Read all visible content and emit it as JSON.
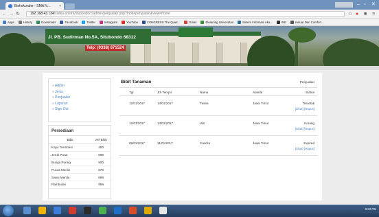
{
  "browser": {
    "tab_title": "Bishokuruler - SMA N...",
    "tab_close": "×",
    "user_chip": "",
    "url_host": "192.168.43.134",
    "url_path": "/sistka-smant/stubondo/c/admin/penjualan.php?mod=penjualan&view=home",
    "bookmarks": [
      {
        "label": "Apps",
        "color": "#4a7cc9"
      },
      {
        "label": "History",
        "color": "#777777"
      },
      {
        "label": "Downloads",
        "color": "#2e8b57"
      },
      {
        "label": "Facebook",
        "color": "#3b5998"
      },
      {
        "label": "Twitter",
        "color": "#1da1f2"
      },
      {
        "label": "Instagram",
        "color": "#c13584"
      },
      {
        "label": "YouTube",
        "color": "#e52d27"
      },
      {
        "label": "CONGRESS The Quiet...",
        "color": "#2a4d8f"
      },
      {
        "label": "Gmail",
        "color": "#d44638"
      },
      {
        "label": "Elearning Universitas",
        "color": "#3a8f3a"
      },
      {
        "label": "Sistem Informasi Aka...",
        "color": "#2a6f97"
      },
      {
        "label": "INE",
        "color": "#333333"
      },
      {
        "label": "Keluar Dari Comfort...",
        "color": "#555555"
      }
    ]
  },
  "banner": {
    "address_line": "Jl. PB. Sudirman No.5A, Situbondo 68312",
    "phone_line": "Telp: (0338) 671524"
  },
  "menu": {
    "items": [
      "Admin",
      "Jenis",
      "Penjualan",
      "Laporan",
      "Sign Out"
    ]
  },
  "stock": {
    "title": "Persediaan",
    "headers": [
      "Bibit",
      "Jml Bibit"
    ],
    "rows": [
      {
        "name": "Kayu Trembesi",
        "qty": "400"
      },
      {
        "name": "Jeruk Purut",
        "qty": "899"
      },
      {
        "name": "Bunga Puring",
        "qty": "900"
      },
      {
        "name": "Pucuk Merah",
        "qty": "878"
      },
      {
        "name": "Sawo Manila",
        "qty": "899"
      },
      {
        "name": "Rambutan",
        "qty": "999"
      }
    ]
  },
  "main": {
    "title": "Bibit Tanaman",
    "right_label": "Penjualan",
    "columns": [
      "Tgl",
      "Jth Tempo",
      "Nama",
      "Alamat",
      "Status"
    ],
    "rows": [
      {
        "tgl": "12/01/2017",
        "tempo": "14/01/2017",
        "nama": "Fatwa",
        "alamat": "Jawa Timur",
        "status": "Tercetak",
        "actions": "[Lihat] [Hapus]"
      },
      {
        "tgl": "12/01/2017",
        "tempo": "14/01/2017",
        "nama": "Visi",
        "alamat": "Jawa Timur",
        "status": "Kurang",
        "actions": "[Lihat] [Hapus]"
      },
      {
        "tgl": "09/01/2017",
        "tempo": "11/01/2017",
        "nama": "Candra",
        "alamat": "Jawa Timur",
        "status": "Expired",
        "actions": "[Lihat] [Hapus]"
      }
    ]
  },
  "taskbar": {
    "time": "9:22 PM",
    "apps": [
      {
        "color": "#5b8fd0"
      },
      {
        "color": "#f0b400"
      },
      {
        "color": "#3b7dd8"
      },
      {
        "color": "#cf3b2f"
      },
      {
        "color": "#2b2b2b"
      },
      {
        "color": "#4caf50"
      },
      {
        "color": "#1f6fc5"
      },
      {
        "color": "#d94b2b"
      },
      {
        "color": "#e0a800"
      },
      {
        "color": "#e6e6e6"
      }
    ]
  }
}
